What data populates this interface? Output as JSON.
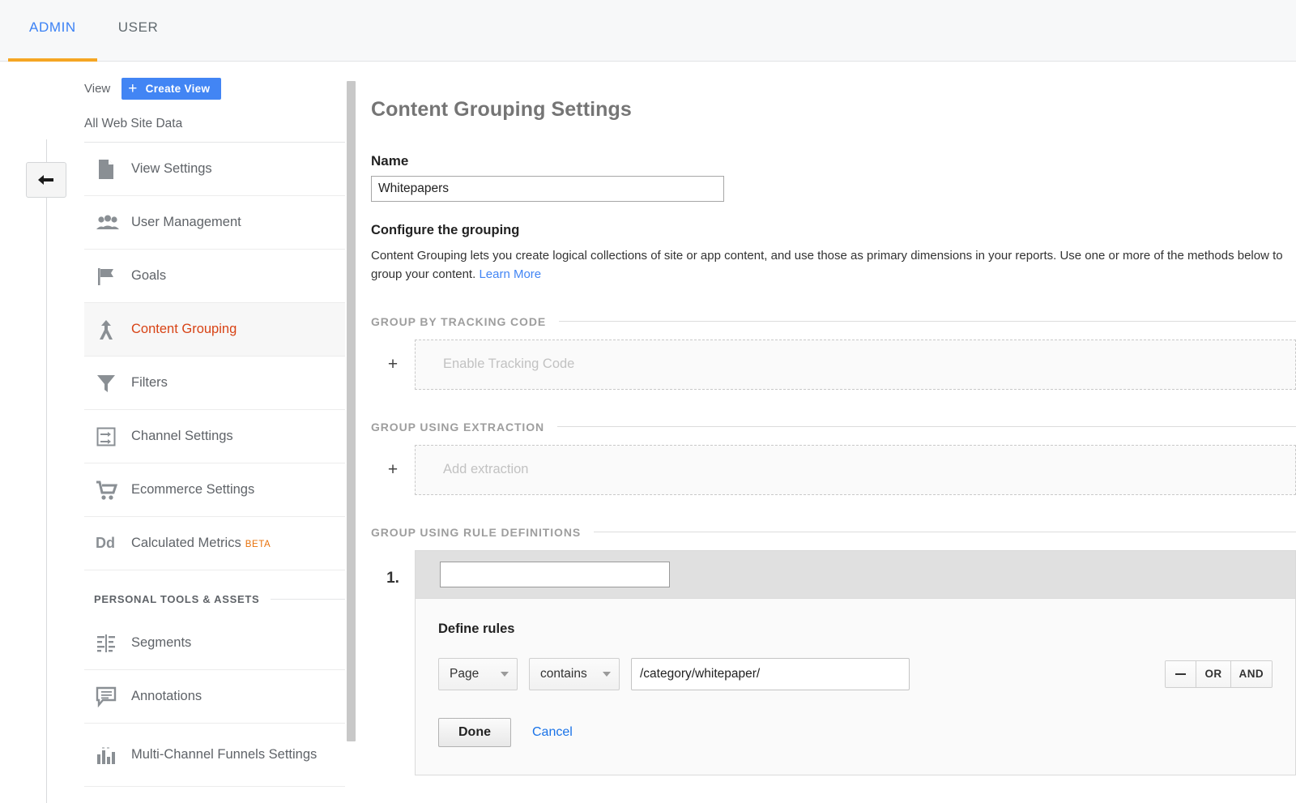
{
  "topbar": {
    "tabs": [
      {
        "label": "ADMIN",
        "active": true
      },
      {
        "label": "USER",
        "active": false
      }
    ]
  },
  "sidebar": {
    "view_label": "View",
    "create_view_label": "Create View",
    "create_view_plus": "+",
    "view_name": "All Web Site Data",
    "items": [
      {
        "label": "View Settings",
        "icon": "document-icon",
        "active": false
      },
      {
        "label": "User Management",
        "icon": "people-icon",
        "active": false
      },
      {
        "label": "Goals",
        "icon": "flag-icon",
        "active": false
      },
      {
        "label": "Content Grouping",
        "icon": "content-grouping-icon",
        "active": true
      },
      {
        "label": "Filters",
        "icon": "funnel-icon",
        "active": false
      },
      {
        "label": "Channel Settings",
        "icon": "channel-icon",
        "active": false
      },
      {
        "label": "Ecommerce Settings",
        "icon": "cart-icon",
        "active": false
      },
      {
        "label": "Calculated Metrics",
        "badge": "BETA",
        "icon": "dd-icon",
        "active": false
      }
    ],
    "personal_section_title": "PERSONAL TOOLS & ASSETS",
    "personal_items": [
      {
        "label": "Segments",
        "icon": "segments-icon"
      },
      {
        "label": "Annotations",
        "icon": "annotation-icon"
      },
      {
        "label": "Multi-Channel Funnels Settings",
        "icon": "bar-chart-icon"
      }
    ]
  },
  "main": {
    "page_title": "Content Grouping Settings",
    "name_label": "Name",
    "name_value": "Whitepapers",
    "configure_heading": "Configure the grouping",
    "description": "Content Grouping lets you create logical collections of site or app content, and use those as primary dimensions in your reports. Use one or more of the methods below to group your content.",
    "learn_more": "Learn More",
    "groups": [
      {
        "title": "GROUP BY TRACKING CODE",
        "placeholder": "Enable Tracking Code",
        "plus": "+"
      },
      {
        "title": "GROUP USING EXTRACTION",
        "placeholder": "Add extraction",
        "plus": "+"
      }
    ],
    "rule_definitions": {
      "title": "GROUP USING RULE DEFINITIONS",
      "number": "1.",
      "name_value": "",
      "name_placeholder": "",
      "define_rules_label": "Define rules",
      "dimension": "Page",
      "operator": "contains",
      "value": "/category/whitepaper/",
      "logic": {
        "remove": "−",
        "or": "OR",
        "and": "AND"
      },
      "done_label": "Done",
      "cancel_label": "Cancel"
    }
  },
  "colors": {
    "accent_blue": "#4285f4",
    "active_orange": "#f5a623",
    "active_item_red": "#d84315",
    "beta_orange": "#e8710a",
    "link_blue": "#1a73e8"
  }
}
